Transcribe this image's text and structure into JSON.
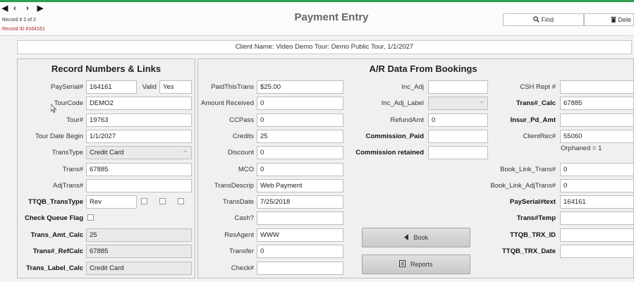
{
  "nav": {
    "first": "◀",
    "prev": "‹",
    "next": "›",
    "last": "▶"
  },
  "record": {
    "count_text": "Record # 2 of 2",
    "id_text": "Record ID #164161"
  },
  "title": "Payment Entry",
  "toolbar": {
    "find_label": "Find",
    "delete_label": "Dele"
  },
  "client_name": "Client Name: Video Demo Tour: Demo Public Tour, 1/1/2027",
  "left_panel": {
    "title": "Record Numbers & Links",
    "payserial_label": "PaySerial#",
    "payserial_value": "164161",
    "valid_label": "Valid",
    "valid_value": "Yes",
    "tourcode_label": "TourCode",
    "tourcode_value": "DEMO2",
    "tour_label": "Tour#",
    "tour_value": "19763",
    "tourdate_label": "Tour Date Begin",
    "tourdate_value": "1/1/2027",
    "transtype_label": "TransType",
    "transtype_value": "Credit Card",
    "trans_label": "Trans#",
    "trans_value": "67885",
    "adjtrans_label": "AdjTrans#",
    "adjtrans_value": "",
    "ttqb_label": "TTQB_TransType",
    "ttqb_value": "Rev",
    "checkqueue_label": "Check Queue Flag",
    "transamt_label": "Trans_Amt_Calc",
    "transamt_value": "25",
    "transref_label": "Trans#_RefCalc",
    "transref_value": "67885",
    "translabel_label": "Trans_Label_Calc",
    "translabel_value": "Credit Card"
  },
  "right_panel": {
    "title": "A/R Data From Bookings",
    "col1": {
      "paidthistrans_label": "PaidThisTrans",
      "paidthistrans_value": "$25.00",
      "amountreceived_label": "Amount Received",
      "amountreceived_value": "0",
      "ccpass_label": "CCPass",
      "ccpass_value": "0",
      "credits_label": "Credits",
      "credits_value": "25",
      "discount_label": "Discount",
      "discount_value": "0",
      "mco_label": "MCO",
      "mco_value": "0",
      "transdescrip_label": "TransDescrip",
      "transdescrip_value": "Web Payment",
      "transdate_label": "TransDate",
      "transdate_value": "7/25/2018",
      "cash_label": "Cash?",
      "cash_value": "",
      "resagent_label": "ResAgent",
      "resagent_value": "WWW",
      "transfer_label": "Transfer",
      "transfer_value": "0",
      "check_label": "Check#",
      "check_value": ""
    },
    "col2": {
      "incadj_label": "Inc_Adj",
      "incadj_value": "",
      "incadjlabel_label": "Inc_Adj_Label",
      "incadjlabel_value": "",
      "refundamt_label": "RefundAmt",
      "refundamt_value": "0",
      "commpaid_label": "Commission_Paid",
      "commpaid_value": "",
      "commret_label": "Commission retained",
      "commret_value": "",
      "book_label": "Book",
      "reports_label": "Reports"
    },
    "col3": {
      "cshrept_label": "CSH Rept #",
      "cshrept_value": "",
      "transcalc_label": "Trans#_Calc",
      "transcalc_value": "67885",
      "insur_label": "Insur_Pd_Amt",
      "insur_value": "",
      "clientrec_label": "ClientRec#",
      "clientrec_value": "55060",
      "orphaned_text": "Orphaned = 1",
      "booklinktrans_label": "Book_Link_Trans#",
      "booklinktrans_value": "0",
      "booklinkadj_label": "Book_Link_AdjTrans#",
      "booklinkadj_value": "0",
      "payserialtext_label": "PaySerial#text",
      "payserialtext_value": "164161",
      "transtemp_label": "Trans#Temp",
      "transtemp_value": "",
      "ttqbtrxid_label": "TTQB_TRX_ID",
      "ttqbtrxid_value": "",
      "ttqbtrxdate_label": "TTQB_TRX_Date",
      "ttqbtrxdate_value": ""
    }
  },
  "icons": {
    "find": "magnifier-icon",
    "delete": "trash-icon",
    "book": "arrow-left-icon",
    "reports": "report-icon"
  },
  "colors": {
    "accent": "#2e9e4f",
    "record_id": "#b0202a"
  }
}
